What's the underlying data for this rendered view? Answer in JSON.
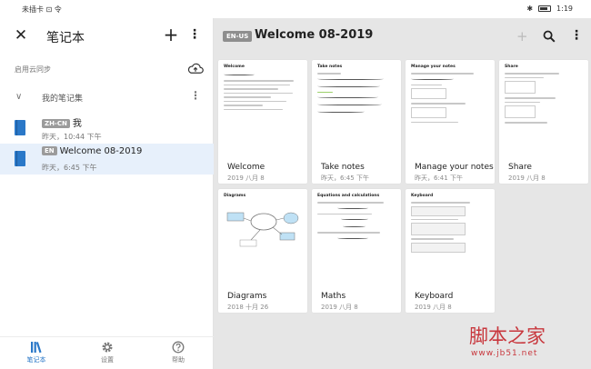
{
  "status_bar": {
    "carrier": "未插卡 ⊡ 令",
    "bluetooth": "✱",
    "time": "1:19"
  },
  "sidebar": {
    "title": "笔记本",
    "sync_label": "启用云同步",
    "group_label": "我的笔记集",
    "notebooks": [
      {
        "lang": "ZH-CN",
        "name": "我",
        "time": "昨天，10:44 下午"
      },
      {
        "lang": "EN",
        "name": "Welcome 08-2019",
        "time": "昨天，6:45 下午"
      }
    ],
    "nav": [
      {
        "label": "笔记本"
      },
      {
        "label": "设置"
      },
      {
        "label": "帮助"
      }
    ]
  },
  "main": {
    "lang": "EN-US",
    "title": "Welcome 08-2019",
    "pages": [
      {
        "thumb_title": "Welcome",
        "title": "Welcome",
        "date": "2019 八月 8"
      },
      {
        "thumb_title": "Take notes",
        "title": "Take notes",
        "date": "昨天，6:45 下午"
      },
      {
        "thumb_title": "Manage your notes",
        "title": "Manage your notes",
        "date": "昨天，6:41 下午"
      },
      {
        "thumb_title": "Share",
        "title": "Share",
        "date": "2019 八月 8"
      },
      {
        "thumb_title": "Diagrams",
        "title": "Diagrams",
        "date": "2018 十月 26"
      },
      {
        "thumb_title": "Equations and calculations",
        "title": "Maths",
        "date": "2019 八月 8"
      },
      {
        "thumb_title": "Keyboard",
        "title": "Keyboard",
        "date": "2019 八月 8"
      }
    ]
  },
  "watermark": {
    "text": "脚本之家",
    "url": "www.jb51.net"
  },
  "colors": {
    "accent": "#2a78c8",
    "selected_row": "#e7f0fb",
    "main_background": "#e6e6e6",
    "watermark": "#c8373d"
  }
}
